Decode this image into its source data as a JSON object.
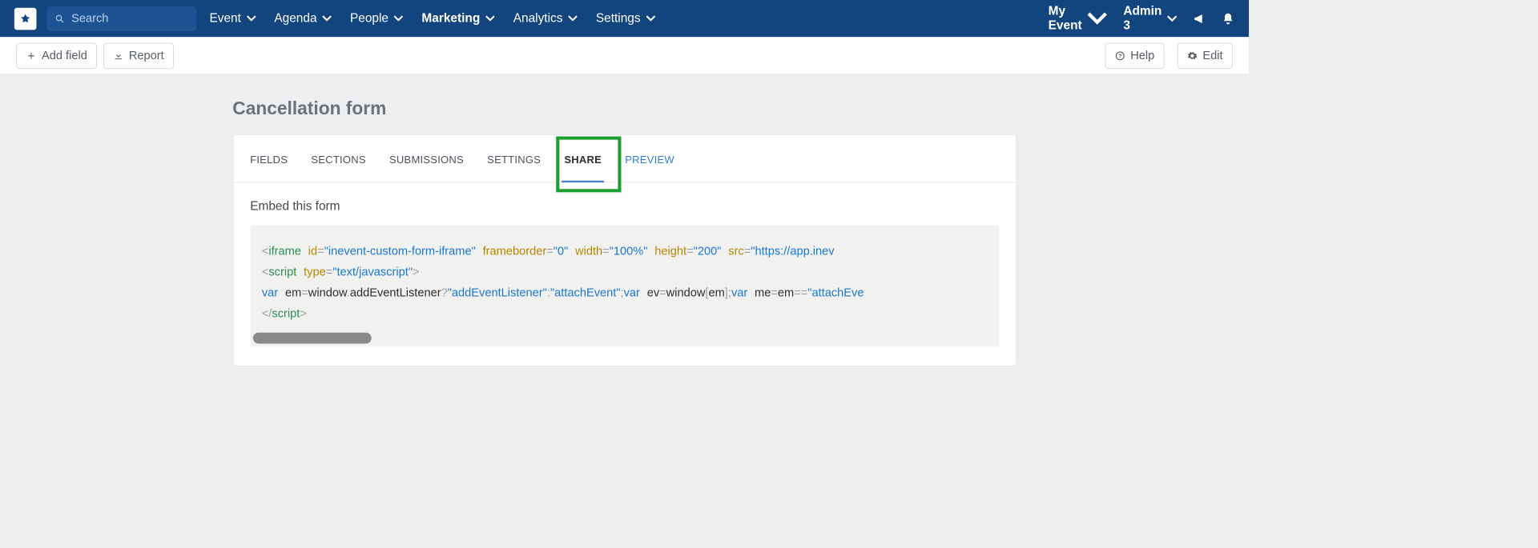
{
  "nav": {
    "search_placeholder": "Search",
    "items": [
      {
        "label": "Event",
        "active": false
      },
      {
        "label": "Agenda",
        "active": false
      },
      {
        "label": "People",
        "active": false
      },
      {
        "label": "Marketing",
        "active": true
      },
      {
        "label": "Analytics",
        "active": false
      },
      {
        "label": "Settings",
        "active": false
      }
    ],
    "event_selector": "My Event",
    "user_label": "Admin 3"
  },
  "actionbar": {
    "add_field": "Add field",
    "report": "Report",
    "help": "Help",
    "edit": "Edit"
  },
  "page": {
    "title": "Cancellation form"
  },
  "tabs": [
    {
      "label": "FIELDS",
      "state": "normal"
    },
    {
      "label": "SECTIONS",
      "state": "normal"
    },
    {
      "label": "SUBMISSIONS",
      "state": "normal"
    },
    {
      "label": "SETTINGS",
      "state": "normal"
    },
    {
      "label": "SHARE",
      "state": "active"
    },
    {
      "label": "PREVIEW",
      "state": "preview"
    }
  ],
  "share": {
    "heading": "Embed this form",
    "code": {
      "iframe_id": "inevent-custom-form-iframe",
      "frameborder": "0",
      "width": "100%",
      "height": "200",
      "src_visible": "https://app.inev",
      "script_type": "text/javascript",
      "js_str_addEventListener": "addEventListener",
      "js_str_attachEvent": "attachEvent",
      "js_str_attachEve_truncated": "attachEve"
    }
  }
}
